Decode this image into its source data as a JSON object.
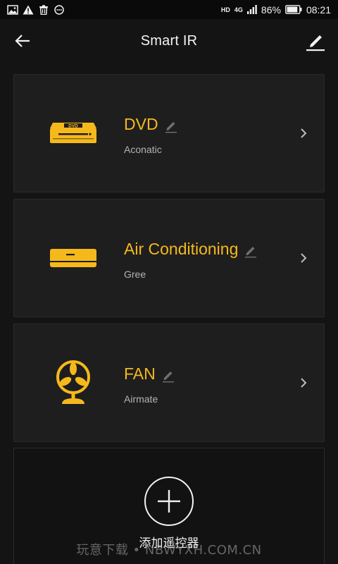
{
  "status_bar": {
    "hd_label": "HD",
    "network_label": "4G",
    "battery_percent": "86%",
    "time": "08:21",
    "left_icons": [
      "image-icon",
      "warning-icon",
      "trash-icon",
      "chat-icon"
    ]
  },
  "header": {
    "title": "Smart IR",
    "back_icon": "arrow-left-icon",
    "edit_icon": "pencil-icon"
  },
  "devices": [
    {
      "name": "DVD",
      "brand": "Aconatic",
      "icon": "dvd-player-icon"
    },
    {
      "name": "Air Conditioning",
      "brand": "Gree",
      "icon": "air-conditioner-icon"
    },
    {
      "name": "FAN",
      "brand": "Airmate",
      "icon": "fan-icon"
    }
  ],
  "add_remote": {
    "label": "添加遥控器",
    "icon": "plus-icon"
  },
  "watermark": "玩意下载 • NBWYXH.COM.CN",
  "colors": {
    "accent": "#f6b91c",
    "background": "#141414",
    "card": "#1e1e1e",
    "secondary_text": "#b4b4b4"
  }
}
